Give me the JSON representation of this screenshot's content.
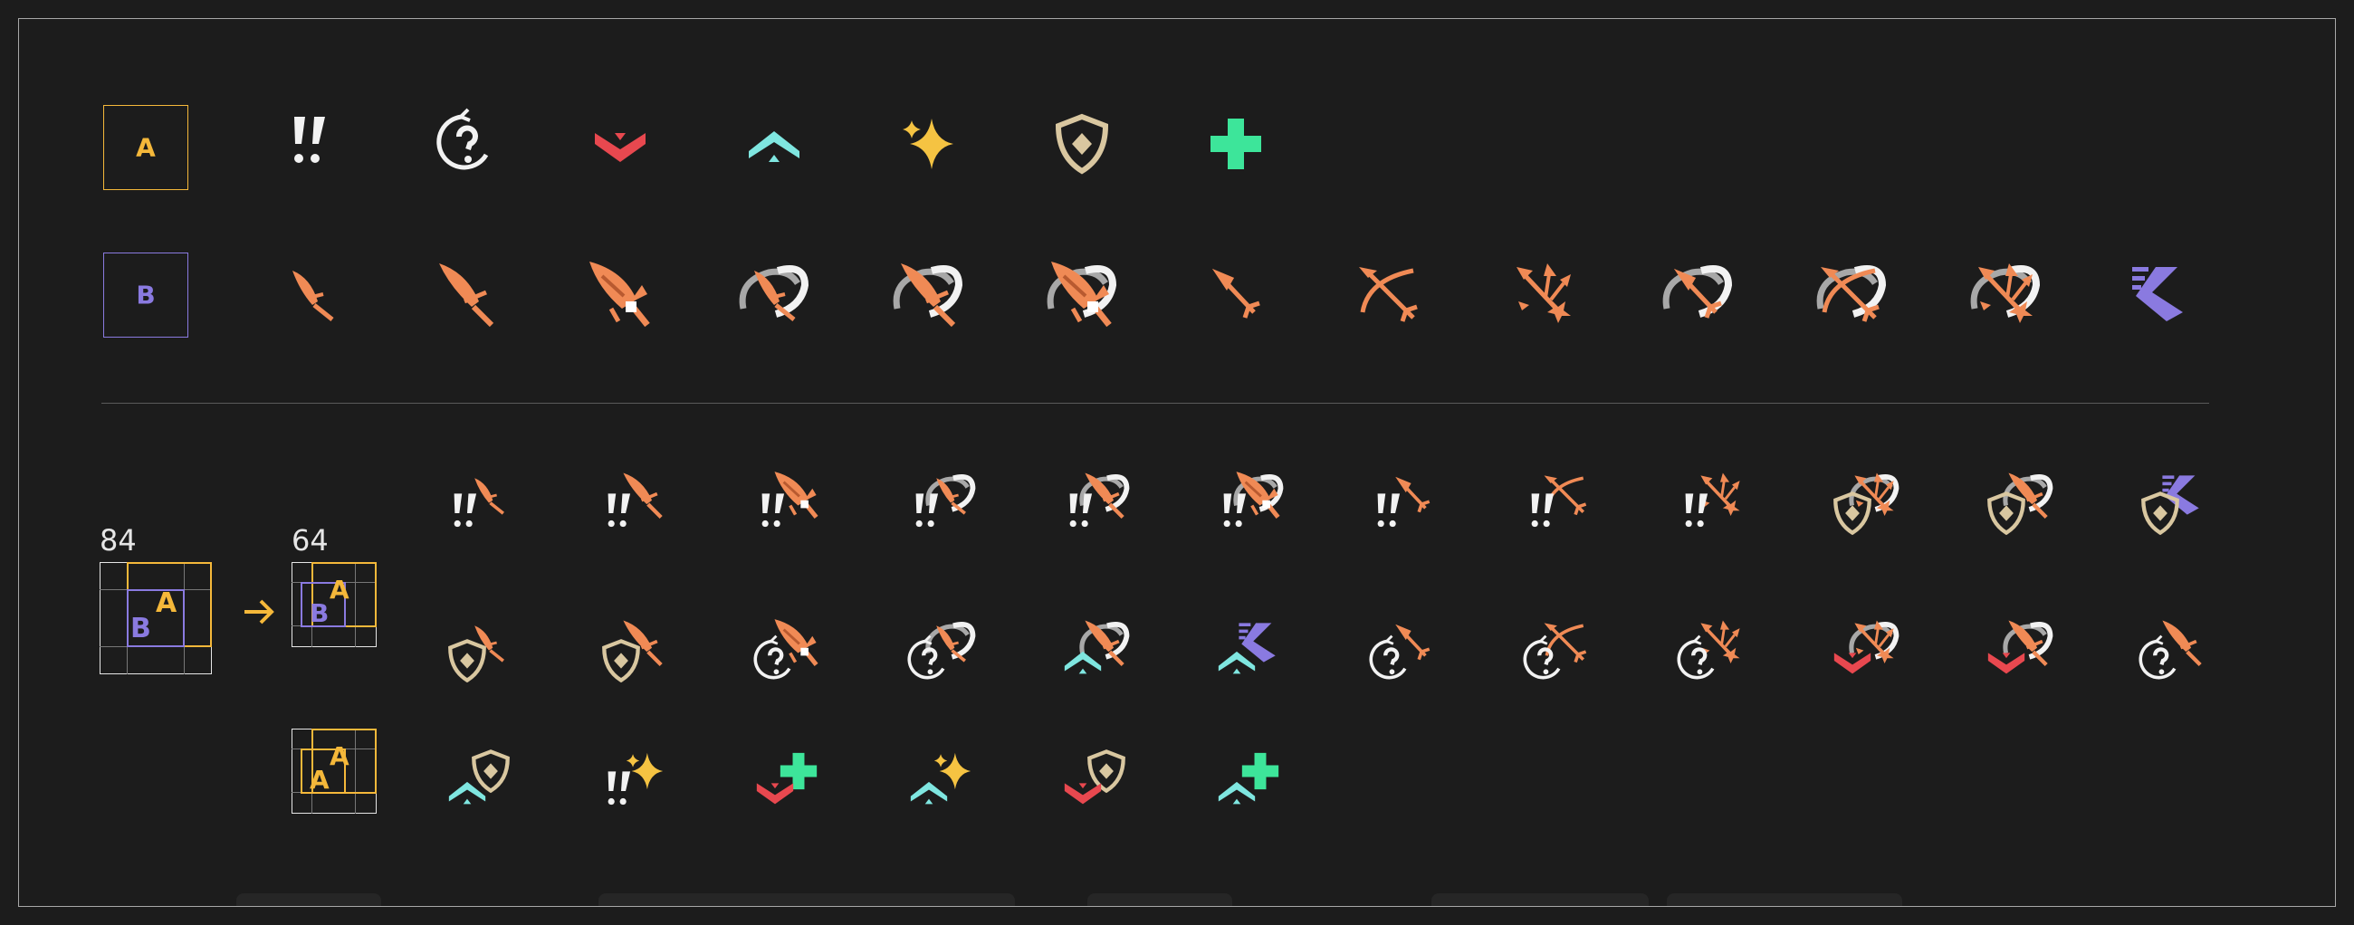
{
  "colors": {
    "background": "#1c1c1c",
    "frame": "#a8a8a8",
    "slot_a": "#f5b83a",
    "slot_b": "#8a7ae0",
    "orange": "#f08a55",
    "red": "#e8484f",
    "cyan": "#7fe6e0",
    "gold": "#f5c342",
    "shield": "#d9c7a0",
    "green": "#3de59a",
    "white": "#f2f2f2",
    "gray": "#a8a8a8"
  },
  "slots": {
    "a_label": "A",
    "b_label": "B"
  },
  "sizes": {
    "large": "84",
    "small": "64"
  },
  "row_a_icons": [
    "exclamation-icon",
    "question-cycle-icon",
    "chevron-down-icon",
    "chevron-up-icon",
    "sparkle-icon",
    "shield-icon",
    "plus-icon"
  ],
  "row_b_icons": [
    "dagger-icon",
    "sword-icon",
    "cleaver-icon",
    "dagger-swing-icon",
    "sword-swing-icon",
    "cleaver-swing-icon",
    "arrow-icon",
    "bow-icon",
    "multi-arrow-icon",
    "arrow-swing-icon",
    "bow-swing-icon",
    "multi-arrow-swing-icon",
    "dash-icon"
  ],
  "combo_rows": [
    [
      "exclamation+dagger",
      "exclamation+sword",
      "exclamation+cleaver",
      "exclamation+dagger-swing",
      "exclamation+sword-swing",
      "exclamation+cleaver-swing",
      "exclamation+arrow",
      "exclamation+bow",
      "exclamation+multi-arrow",
      "shield+multi-arrow-swing",
      "shield+sword-swing",
      "shield+dash"
    ],
    [
      "shield+dagger",
      "shield+sword",
      "question+cleaver",
      "question+dagger-swing",
      "chevron-up+sword-swing",
      "chevron-up+dash",
      "question+arrow",
      "question+bow",
      "question+multi-arrow",
      "chevron-down+multi-arrow-swing",
      "chevron-down+sword-swing",
      "question+sword"
    ],
    [
      "chevron-up+shield",
      "exclamation+sparkle",
      "chevron-down+plus",
      "chevron-up+sparkle",
      "chevron-down+shield",
      "chevron-up+plus"
    ]
  ]
}
